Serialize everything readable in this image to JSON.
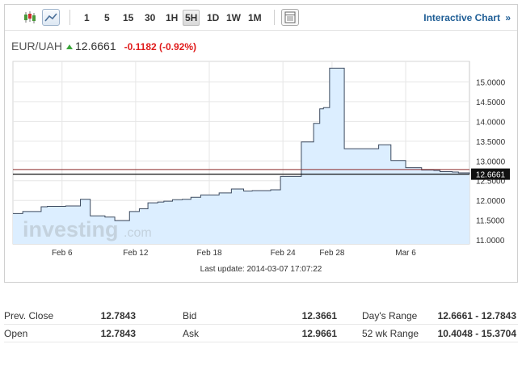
{
  "toolbar": {
    "timeframes": [
      "1",
      "5",
      "15",
      "30",
      "1H",
      "5H",
      "1D",
      "1W",
      "1M"
    ],
    "active_timeframe": "5H",
    "interactive_label": "Interactive Chart",
    "interactive_arrow": "»"
  },
  "quote": {
    "symbol": "EUR/UAH",
    "last": "12.6661",
    "change": "-0.1182 (-0.92%)"
  },
  "chart_data": {
    "type": "area",
    "x": [
      0.0,
      0.8,
      1.8,
      2.3,
      2.8,
      3.3,
      4.0,
      4.3,
      5.0,
      5.5,
      5.8,
      6.3,
      6.8,
      7.5,
      8.3,
      9.0,
      9.5,
      10.3,
      11.0,
      11.8,
      12.3,
      13.0,
      13.8,
      14.5,
      15.3,
      16.0,
      16.8,
      17.8,
      18.8,
      19.5,
      20.3,
      21.0,
      21.8,
      22.5,
      22.8,
      23.5,
      24.0,
      24.5,
      25.0,
      25.3,
      25.8,
      26.0,
      26.3,
      26.5,
      27.0,
      27.8,
      28.0,
      28.8,
      29.8,
      30.3,
      30.8,
      31.3,
      32.0,
      32.5,
      33.3,
      33.8,
      34.3,
      34.8,
      35.3,
      35.8,
      36.3,
      36.8,
      37.2
    ],
    "values": [
      11.67,
      11.72,
      11.72,
      11.84,
      11.85,
      11.85,
      11.85,
      11.86,
      11.86,
      12.03,
      12.03,
      11.61,
      11.61,
      11.58,
      11.49,
      11.49,
      11.72,
      11.79,
      11.94,
      11.96,
      11.98,
      12.02,
      12.03,
      12.08,
      12.14,
      12.14,
      12.19,
      12.29,
      12.24,
      12.25,
      12.25,
      12.27,
      12.61,
      12.61,
      12.61,
      13.48,
      13.48,
      13.95,
      14.32,
      14.35,
      15.35,
      15.35,
      15.35,
      15.35,
      13.31,
      13.31,
      13.31,
      13.31,
      13.41,
      13.41,
      13.01,
      13.01,
      12.83,
      12.83,
      12.77,
      12.77,
      12.76,
      12.73,
      12.73,
      12.72,
      12.7,
      12.7,
      12.67
    ],
    "xticks": [
      {
        "x": 4.0,
        "label": "Feb 6"
      },
      {
        "x": 10.0,
        "label": "Feb 12"
      },
      {
        "x": 16.0,
        "label": "Feb 18"
      },
      {
        "x": 22.0,
        "label": "Feb 24"
      },
      {
        "x": 26.0,
        "label": "Feb 28"
      },
      {
        "x": 32.0,
        "label": "Mar 6"
      }
    ],
    "yticks": [
      "11.0000",
      "11.5000",
      "12.0000",
      "12.5000",
      "13.0000",
      "13.5000",
      "14.0000",
      "14.5000",
      "15.0000"
    ],
    "ylim": [
      10.9,
      15.52
    ],
    "xlim": [
      0,
      37.2
    ],
    "current_price": 12.6661,
    "current_label": "12.6661",
    "prev_close": 12.7843,
    "grid": true,
    "last_update": "Last update: 2014-03-07 17:07:22",
    "watermark": {
      "brand": "investing",
      "suffix": ".com"
    },
    "colors": {
      "line": "#3c4a5f",
      "fill": "#dceeff",
      "prev_close": "#8b2a2a",
      "current": "#111111",
      "grid": "#e6e6e6"
    }
  },
  "stats": [
    [
      {
        "label": "Prev. Close",
        "value": "12.7843"
      },
      {
        "label": "Bid",
        "value": "12.3661"
      },
      {
        "label": "Day's Range",
        "value": "12.6661 - 12.7843"
      }
    ],
    [
      {
        "label": "Open",
        "value": "12.7843"
      },
      {
        "label": "Ask",
        "value": "12.9661"
      },
      {
        "label": "52 wk Range",
        "value": "10.4048 - 15.3704"
      }
    ]
  ]
}
